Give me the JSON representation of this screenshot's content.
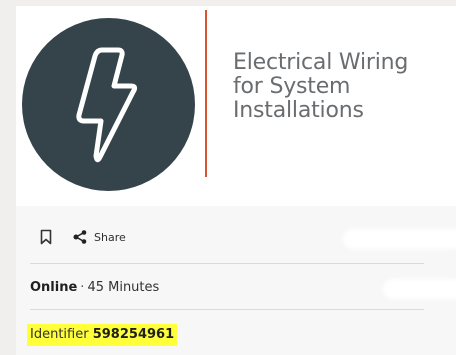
{
  "course": {
    "title_line1": "Electrical Wiring",
    "title_line2": "for System",
    "title_line3": "Installations",
    "logo_icon": "lightning-bolt-icon"
  },
  "actions": {
    "bookmark_icon": "bookmark-icon",
    "share_icon": "share-icon",
    "share_label": "Share"
  },
  "meta": {
    "delivery": "Online",
    "separator": "·",
    "duration": "45 Minutes"
  },
  "identifier": {
    "label": "Identifier",
    "value": "598254961"
  },
  "colors": {
    "logo_bg": "#35444b",
    "accent_line": "#d9542f",
    "highlight": "#ffff3a"
  }
}
